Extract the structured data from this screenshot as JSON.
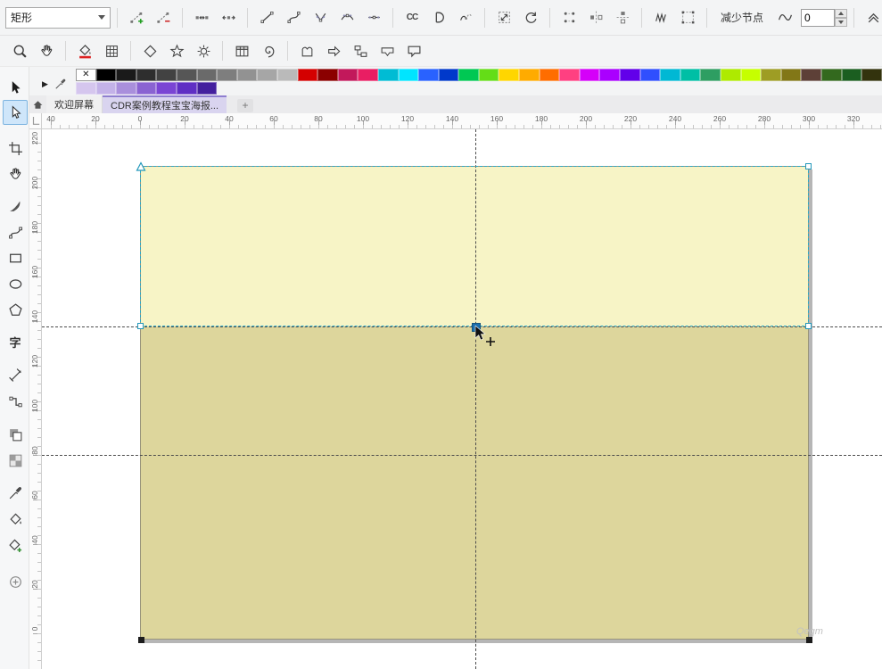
{
  "property_bar": {
    "shape_preset": "矩形",
    "reduce_nodes_label": "减少节点",
    "smoothness_value": "0",
    "reverse_glyph": "CC"
  },
  "toolbox": {
    "text_tool_glyph": "字"
  },
  "palette": {
    "no_color_glyph": "✕",
    "flyout_glyph": "▶",
    "row1": [
      "#000000",
      "#1a1a1a",
      "#2e2e2e",
      "#424242",
      "#565656",
      "#6a6a6a",
      "#7e7e7e",
      "#929292",
      "#a6a6a6",
      "#bababa",
      "#d40000",
      "#8b0000",
      "#c2185b",
      "#e91e63",
      "#00bcd4",
      "#00e5ff",
      "#2962ff",
      "#0039cb",
      "#00c853",
      "#64dd17",
      "#ffd600",
      "#ffab00",
      "#ff6d00",
      "#ff4081",
      "#d500f9",
      "#aa00ff",
      "#6200ea",
      "#304ffe",
      "#00b8d4",
      "#00bfa5",
      "#2e9e62",
      "#aeea00",
      "#c6ff00",
      "#9e9d24",
      "#827717",
      "#5d4037",
      "#33691e",
      "#1b5e20",
      "#33330d",
      "#111111"
    ],
    "row2": [
      "#d5c6ee",
      "#c3b2e8",
      "#a98fdc",
      "#8a63d2",
      "#7a45d4",
      "#5f2fc4",
      "#44209e"
    ]
  },
  "tabs": {
    "welcome": "欢迎屏幕",
    "document": "CDR案例教程宝宝海报...",
    "new_tab": "+"
  },
  "rulers": {
    "h_labels": [
      "40",
      "20",
      "0",
      "20",
      "40",
      "60",
      "80",
      "100",
      "120",
      "140",
      "160",
      "180",
      "200",
      "220",
      "240",
      "260",
      "280",
      "300",
      "320"
    ],
    "v_labels": [
      "220",
      "200",
      "180",
      "160",
      "140",
      "120",
      "100",
      "80",
      "60",
      "40",
      "20",
      "0"
    ]
  },
  "canvas": {
    "watermark": "Qeqm",
    "top_fill": "#f7f4c6",
    "bottom_fill": "#ddd69c",
    "selection_color": "#2aa9c9",
    "guide_color": "#4c4c4c"
  }
}
